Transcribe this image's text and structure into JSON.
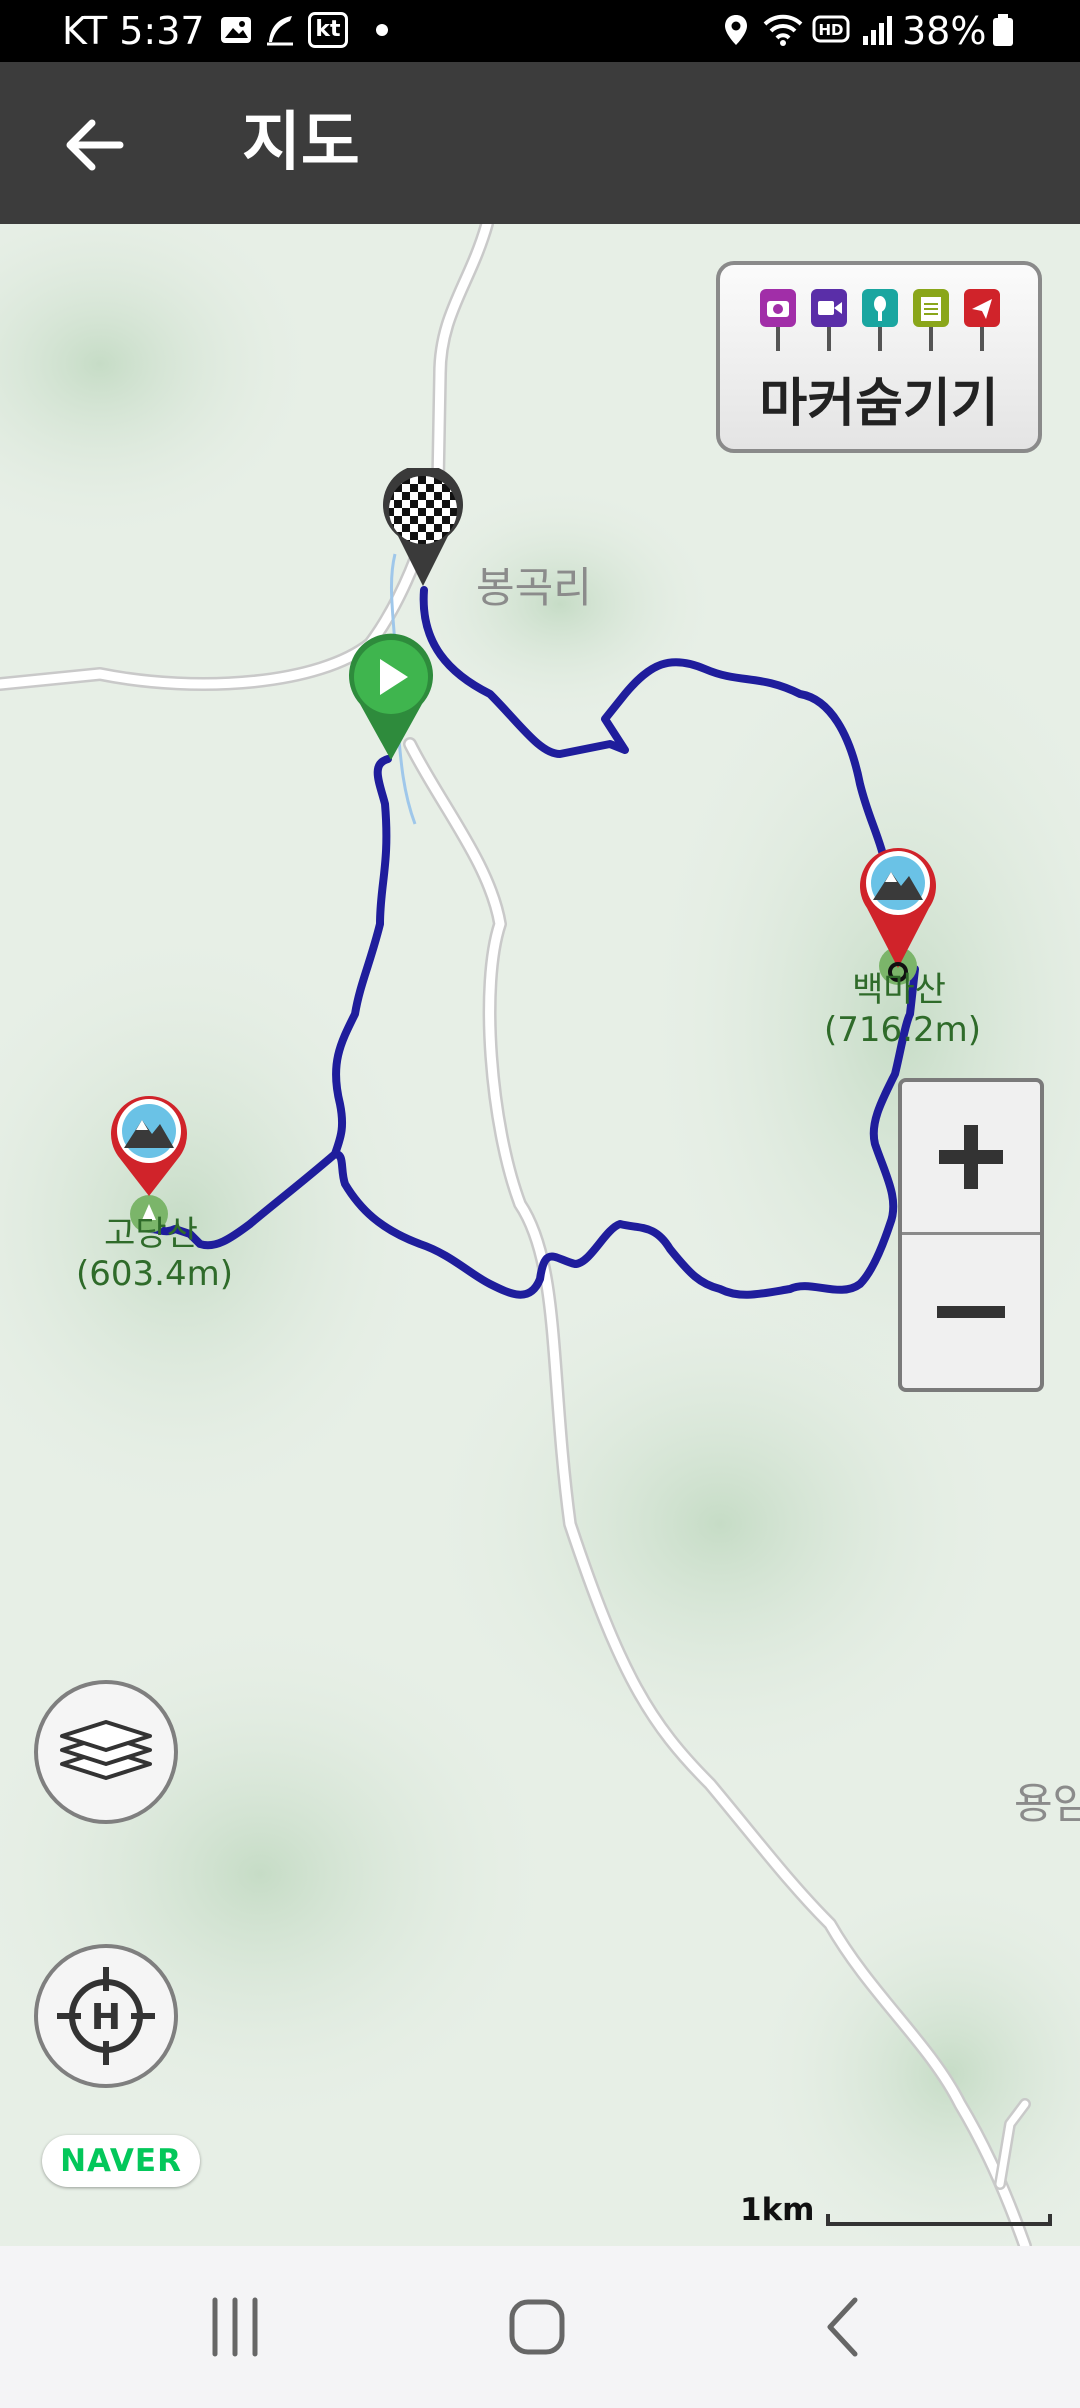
{
  "status_bar": {
    "carrier_time": "KT 5:37",
    "kt_badge": "kt",
    "battery": "38%",
    "icons": [
      "gallery-icon",
      "feather-icon",
      "kt-icon",
      "dot-icon",
      "location-icon",
      "wifi-icon",
      "hd-icon",
      "signal-icon",
      "battery-icon"
    ]
  },
  "app_bar": {
    "back_icon": "arrow-left-icon",
    "title": "지도"
  },
  "map": {
    "marker_toggle": {
      "label": "마커숨기기",
      "pin_icons": [
        "camera-pin-icon",
        "video-pin-icon",
        "mic-pin-icon",
        "memo-pin-icon",
        "flag-pin-icon"
      ],
      "pin_colors": [
        "#a12ea8",
        "#5a2ea8",
        "#1aa6a0",
        "#8aa61a",
        "#d0232a"
      ]
    },
    "labels": {
      "village": "봉곡리",
      "village_right": "용암",
      "peak1_name": "백마산",
      "peak1_alt": "(716.2m)",
      "peak2_name": "고당산",
      "peak2_alt": "(603.4m)"
    },
    "route_color": "#1f1d9c",
    "zoom": {
      "in_icon": "plus-icon",
      "out_icon": "minus-icon"
    },
    "layers_icon": "layers-icon",
    "locate_icon": "crosshair-h-icon",
    "brand": "NAVER",
    "scale_label": "1km"
  },
  "nav_bar": {
    "icons": [
      "recent-apps-icon",
      "home-icon",
      "back-icon"
    ]
  }
}
